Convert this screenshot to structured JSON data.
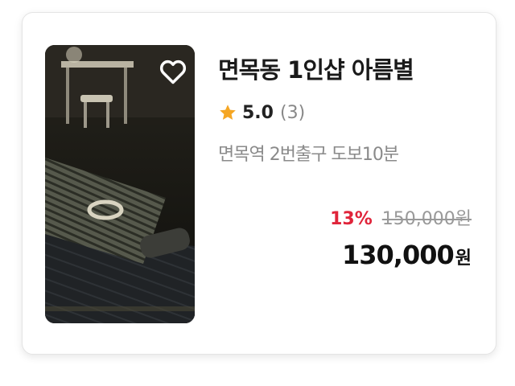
{
  "listing": {
    "title": "면목동 1인샵 아름별",
    "rating": {
      "score": "5.0",
      "count": "(3)"
    },
    "location": "면목역 2번출구 도보10분",
    "price": {
      "discount": "13%",
      "original": "150,000원",
      "final": "130,000",
      "final_unit": "원"
    },
    "photo_alt": "dark room with massage mat and towel",
    "icons": {
      "favorite": "heart-outline-icon",
      "rating": "star-icon"
    },
    "colors": {
      "star": "#f5a623",
      "discount": "#e0243a"
    }
  }
}
